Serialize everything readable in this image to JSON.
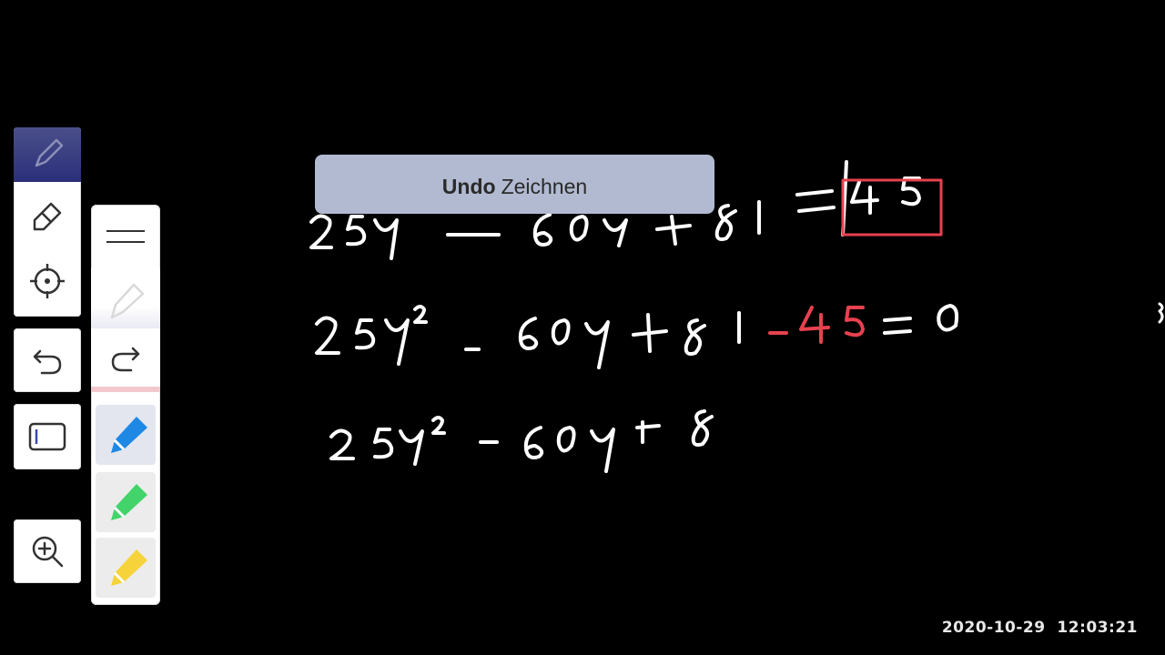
{
  "toast": {
    "action": "Undo",
    "message": "Zeichnen"
  },
  "timestamp": "2020-10-29  12:03:21",
  "board": {
    "equation_1": "25y² − 60y + 81 = 45",
    "equation_1_boxed_value": "45",
    "equation_2_left": "25y² - 60y + 81",
    "equation_2_red": "-45",
    "equation_2_right": "= 0",
    "equation_3": "25y²-60y+8"
  },
  "toolbar": {
    "tools": [
      "pen",
      "eraser",
      "lasso",
      "undo",
      "redo",
      "text-box",
      "zoom-in"
    ],
    "pen_colors": [
      "#e8414f",
      "#1e88e5",
      "#43d36b",
      "#f6d33a"
    ]
  },
  "colors": {
    "background": "#000000",
    "ink": "#ffffff",
    "ink_accent": "#e8414f",
    "active_tool": "#2b2f7a"
  }
}
